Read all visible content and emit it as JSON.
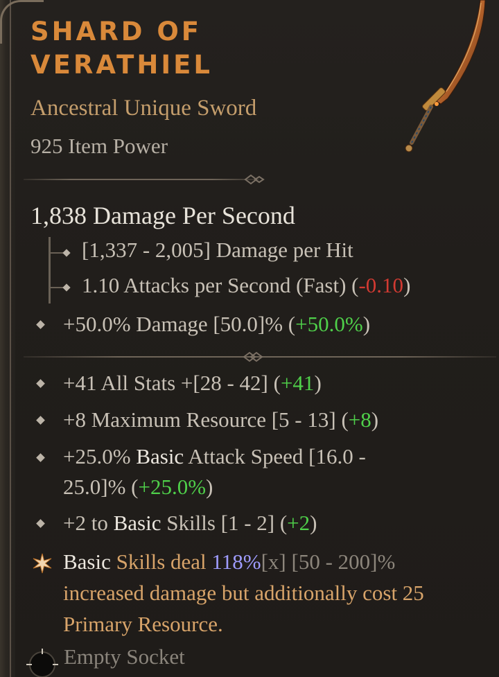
{
  "item": {
    "name_line1": "Shard of",
    "name_line2": "Verathiel",
    "type": "Ancestral Unique Sword",
    "item_power": "925 Item Power"
  },
  "weapon": {
    "dps": "1,838 Damage Per Second",
    "damage_per_hit": "[1,337 - 2,005] Damage per Hit",
    "attack_speed_text": "1.10 Attacks per Second (Fast) (",
    "attack_speed_delta": "-0.10",
    "attack_speed_close": ")"
  },
  "implicit": {
    "text": "+50.0% Damage [50.0]% (",
    "delta": "+50.0%",
    "close": ")"
  },
  "affixes": [
    {
      "pre": "+41 All Stats +[28 - 42] (",
      "delta": "+41",
      "close": ")"
    },
    {
      "pre": "+8 Maximum Resource [5 - 13] (",
      "delta": "+8",
      "close": ")"
    },
    {
      "pre": "+25.0% ",
      "highlight": "Basic",
      "mid": " Attack Speed [16.0 -",
      "line2": "25.0]% (",
      "delta": "+25.0%",
      "close": ")"
    },
    {
      "pre": "+2 to ",
      "highlight": "Basic",
      "mid": " Skills [1 - 2] (",
      "delta": "+2",
      "close": ")"
    }
  ],
  "unique_power": {
    "basic": "Basic",
    "skills_deal": " Skills deal ",
    "value": "118%",
    "x": "[x]",
    "range": " [50 - 200]%",
    "rest": "increased damage but additionally cost 25 Primary Resource."
  },
  "socket": {
    "label": "Empty Socket"
  },
  "colors": {
    "title": "#d9893a",
    "positive": "#4fd04a",
    "negative": "#d23a32",
    "unique_text": "#d8a46a",
    "multiplier": "#9f9cff"
  },
  "icons": [
    "sword-image",
    "diamond-bullet-icon",
    "unique-star-icon",
    "socket-icon"
  ]
}
